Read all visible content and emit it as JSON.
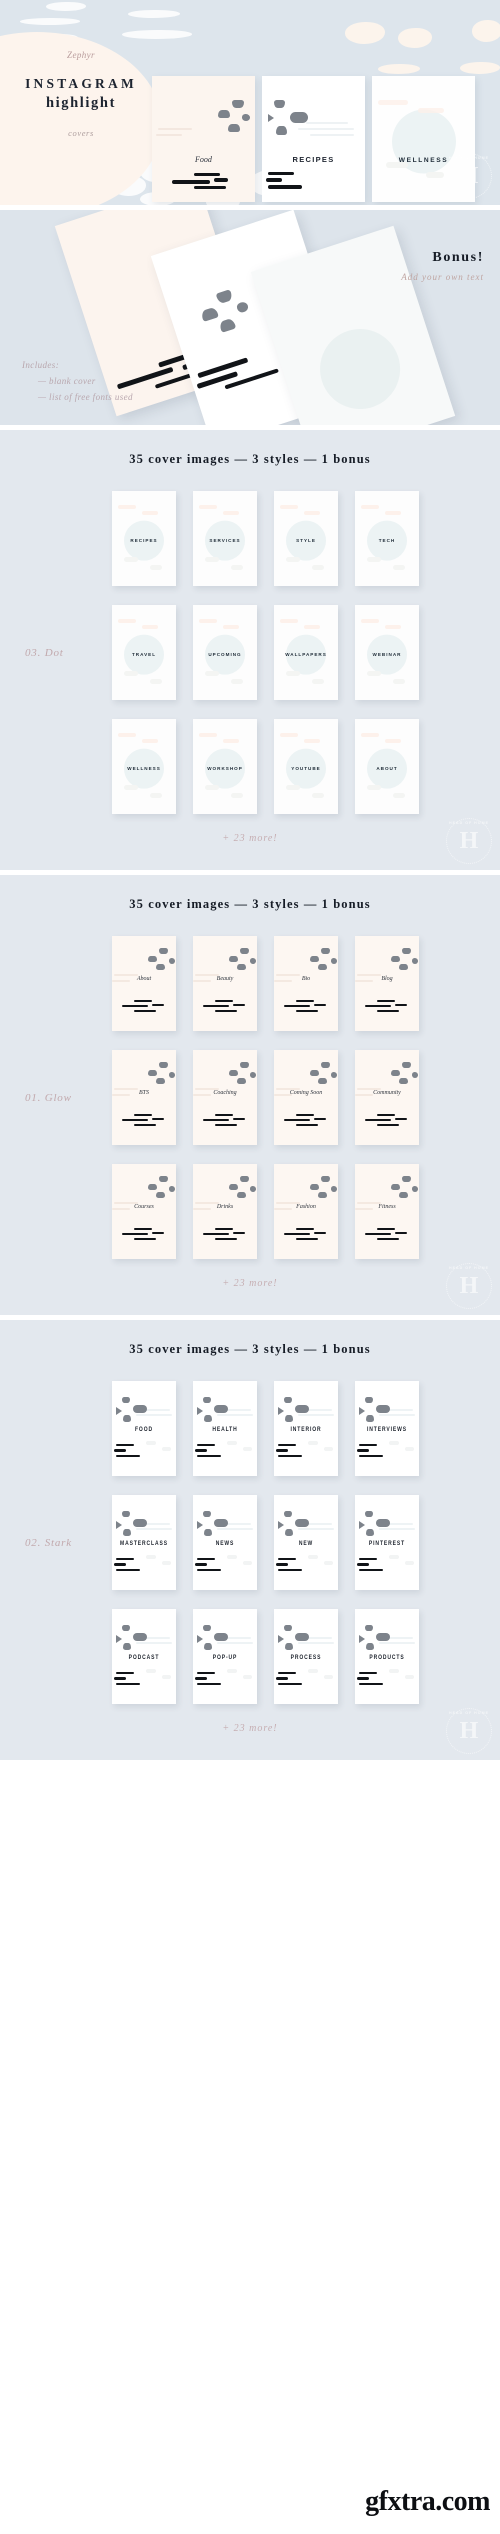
{
  "hero": {
    "brand": "Zephyr",
    "title_line1": "INSTAGRAM",
    "title_line2": "highlight",
    "subtitle": "covers",
    "cards": [
      {
        "label": "Food",
        "style": "glow"
      },
      {
        "label": "RECIPES",
        "style": "stark"
      },
      {
        "label": "WELLNESS",
        "style": "dot"
      }
    ]
  },
  "bonus": {
    "title": "Bonus!",
    "subtitle": "Add your own text",
    "includes_heading": "Includes:",
    "includes_items": [
      "— blank cover",
      "— list of free fonts used"
    ]
  },
  "sections": [
    {
      "id": "dot",
      "title": "35 cover images — 3 styles — 1 bonus",
      "style_label": "03. Dot",
      "card_style": "dot",
      "more": "+ 23 more!",
      "rows": [
        [
          "RECIPES",
          "SERVICES",
          "STYLE",
          "TECH"
        ],
        [
          "TRAVEL",
          "UPCOMING",
          "WALLPAPERS",
          "WEBINAR"
        ],
        [
          "WELLNESS",
          "WORKSHOP",
          "YOUTUBE",
          "ABOUT"
        ]
      ]
    },
    {
      "id": "glow",
      "title": "35 cover images — 3 styles — 1 bonus",
      "style_label": "01. Glow",
      "card_style": "glow",
      "more": "+ 23 more!",
      "rows": [
        [
          "About",
          "Beauty",
          "Bio",
          "Blog"
        ],
        [
          "BTS",
          "Coaching",
          "Coming Soon",
          "Community"
        ],
        [
          "Courses",
          "Drinks",
          "Fashion",
          "Fitness"
        ]
      ]
    },
    {
      "id": "stark",
      "title": "35 cover images — 3 styles — 1 bonus",
      "style_label": "02. Stark",
      "card_style": "stark",
      "more": "+ 23 more!",
      "rows": [
        [
          "FOOD",
          "HEALTH",
          "INTERIOR",
          "INTERVIEWS"
        ],
        [
          "MASTERCLASS",
          "NEWS",
          "NEW",
          "PINTEREST"
        ],
        [
          "PODCAST",
          "POP-UP",
          "PROCESS",
          "PRODUCTS"
        ]
      ]
    }
  ],
  "watermarks": {
    "seal_letter": "H",
    "seal_text": "HEAD OF HOME",
    "site": "gfxtra.com"
  },
  "colors": {
    "bg_blue": "#e3e8ee",
    "hero_blue": "#dde5ec",
    "cream": "#fdf4ed",
    "ink": "#1d2430",
    "rose": "#b99c9c",
    "petal": "#7d838b",
    "dot_circle": "#e7f0f1"
  }
}
